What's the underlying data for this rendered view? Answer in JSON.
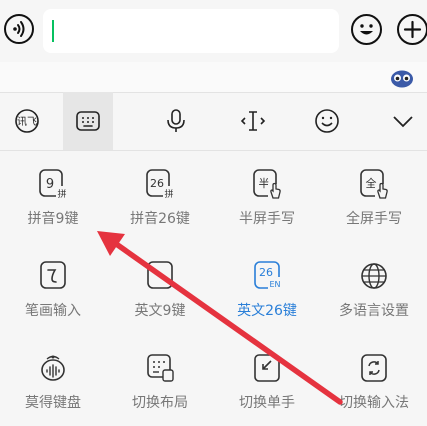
{
  "chat_bar": {
    "input_value": "",
    "caret_color": "#07c160"
  },
  "keyboard": {
    "toolbar": [
      "voice-keyboard-icon",
      "keyboard-icon",
      "microphone-icon",
      "text-cursor-icon",
      "smiley-icon",
      "chevron-down-icon"
    ],
    "grid": [
      {
        "label": "拼音9键",
        "icon_text": "9",
        "sub": "拼"
      },
      {
        "label": "拼音26键",
        "icon_text": "26",
        "sub": "拼"
      },
      {
        "label": "半屏手写",
        "icon_text": "半",
        "sub": ""
      },
      {
        "label": "全屏手写",
        "icon_text": "全",
        "sub": ""
      },
      {
        "label": "笔画输入",
        "icon_text": "㇃",
        "sub": ""
      },
      {
        "label": "英文9键",
        "icon_text": "",
        "sub": ""
      },
      {
        "label": "英文26键",
        "icon_text": "26",
        "sub": "EN"
      },
      {
        "label": "多语言设置",
        "icon_text": "",
        "sub": ""
      },
      {
        "label": "莫得键盘",
        "icon_text": "",
        "sub": ""
      },
      {
        "label": "切换布局",
        "icon_text": "",
        "sub": ""
      },
      {
        "label": "切换单手",
        "icon_text": "",
        "sub": ""
      },
      {
        "label": "切换输入法",
        "icon_text": "",
        "sub": ""
      }
    ],
    "accent_color": "#2a7fd8",
    "annotation_arrow_color": "#e5333f"
  }
}
